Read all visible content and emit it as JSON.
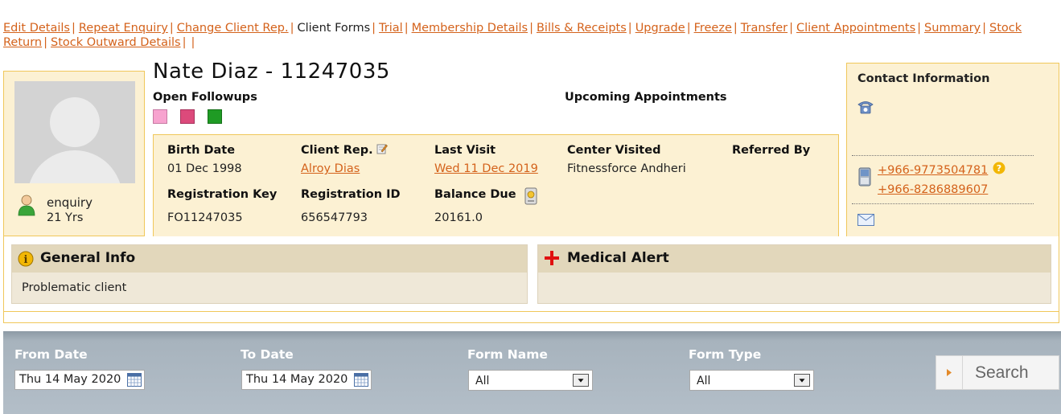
{
  "nav": {
    "items": [
      "Edit Details",
      "Repeat Enquiry",
      "Change Client Rep.",
      "Client Forms",
      "Trial",
      "Membership Details",
      "Bills & Receipts",
      "Upgrade",
      "Freeze",
      "Transfer",
      "Client Appointments",
      "Summary",
      "Stock Return",
      "Stock Outward Details"
    ],
    "separator": "|"
  },
  "client": {
    "name_id": "Nate Diaz - 11247035",
    "stage": "enquiry",
    "age": "21 Yrs",
    "open_followups_label": "Open Followups",
    "upcoming_appointments_label": "Upcoming Appointments",
    "followup_colors": [
      "#f7a3cf",
      "#dc4a7b",
      "#1f9b24"
    ]
  },
  "details": {
    "birth_date_label": "Birth Date",
    "birth_date": "01 Dec 1998",
    "client_rep_label": "Client Rep.",
    "client_rep": "Alroy Dias",
    "last_visit_label": "Last Visit",
    "last_visit": "Wed 11 Dec 2019",
    "center_label": "Center Visited",
    "center": "Fitnessforce Andheri",
    "referred_label": "Referred By",
    "reg_key_label": "Registration Key",
    "reg_key": "FO11247035",
    "reg_id_label": "Registration ID",
    "reg_id": "656547793",
    "balance_label": "Balance Due",
    "balance": "20161.0"
  },
  "contact": {
    "title": "Contact Information",
    "phone1": "+966-9773504781",
    "phone2": "+966-8286889607"
  },
  "general_info": {
    "title": "General Info",
    "text": "Problematic client"
  },
  "medical_alert": {
    "title": "Medical Alert"
  },
  "filters": {
    "from_label": "From Date",
    "from_value": "Thu 14 May 2020",
    "to_label": "To Date",
    "to_value": "Thu 14 May 2020",
    "form_name_label": "Form Name",
    "form_name_value": "All",
    "form_type_label": "Form Type",
    "form_type_value": "All",
    "search_label": "Search"
  },
  "colors": {
    "link": "#d4621b",
    "card_bg": "#fcf1d3",
    "card_border": "#f0c75a",
    "medical_cross": "#e01010"
  }
}
